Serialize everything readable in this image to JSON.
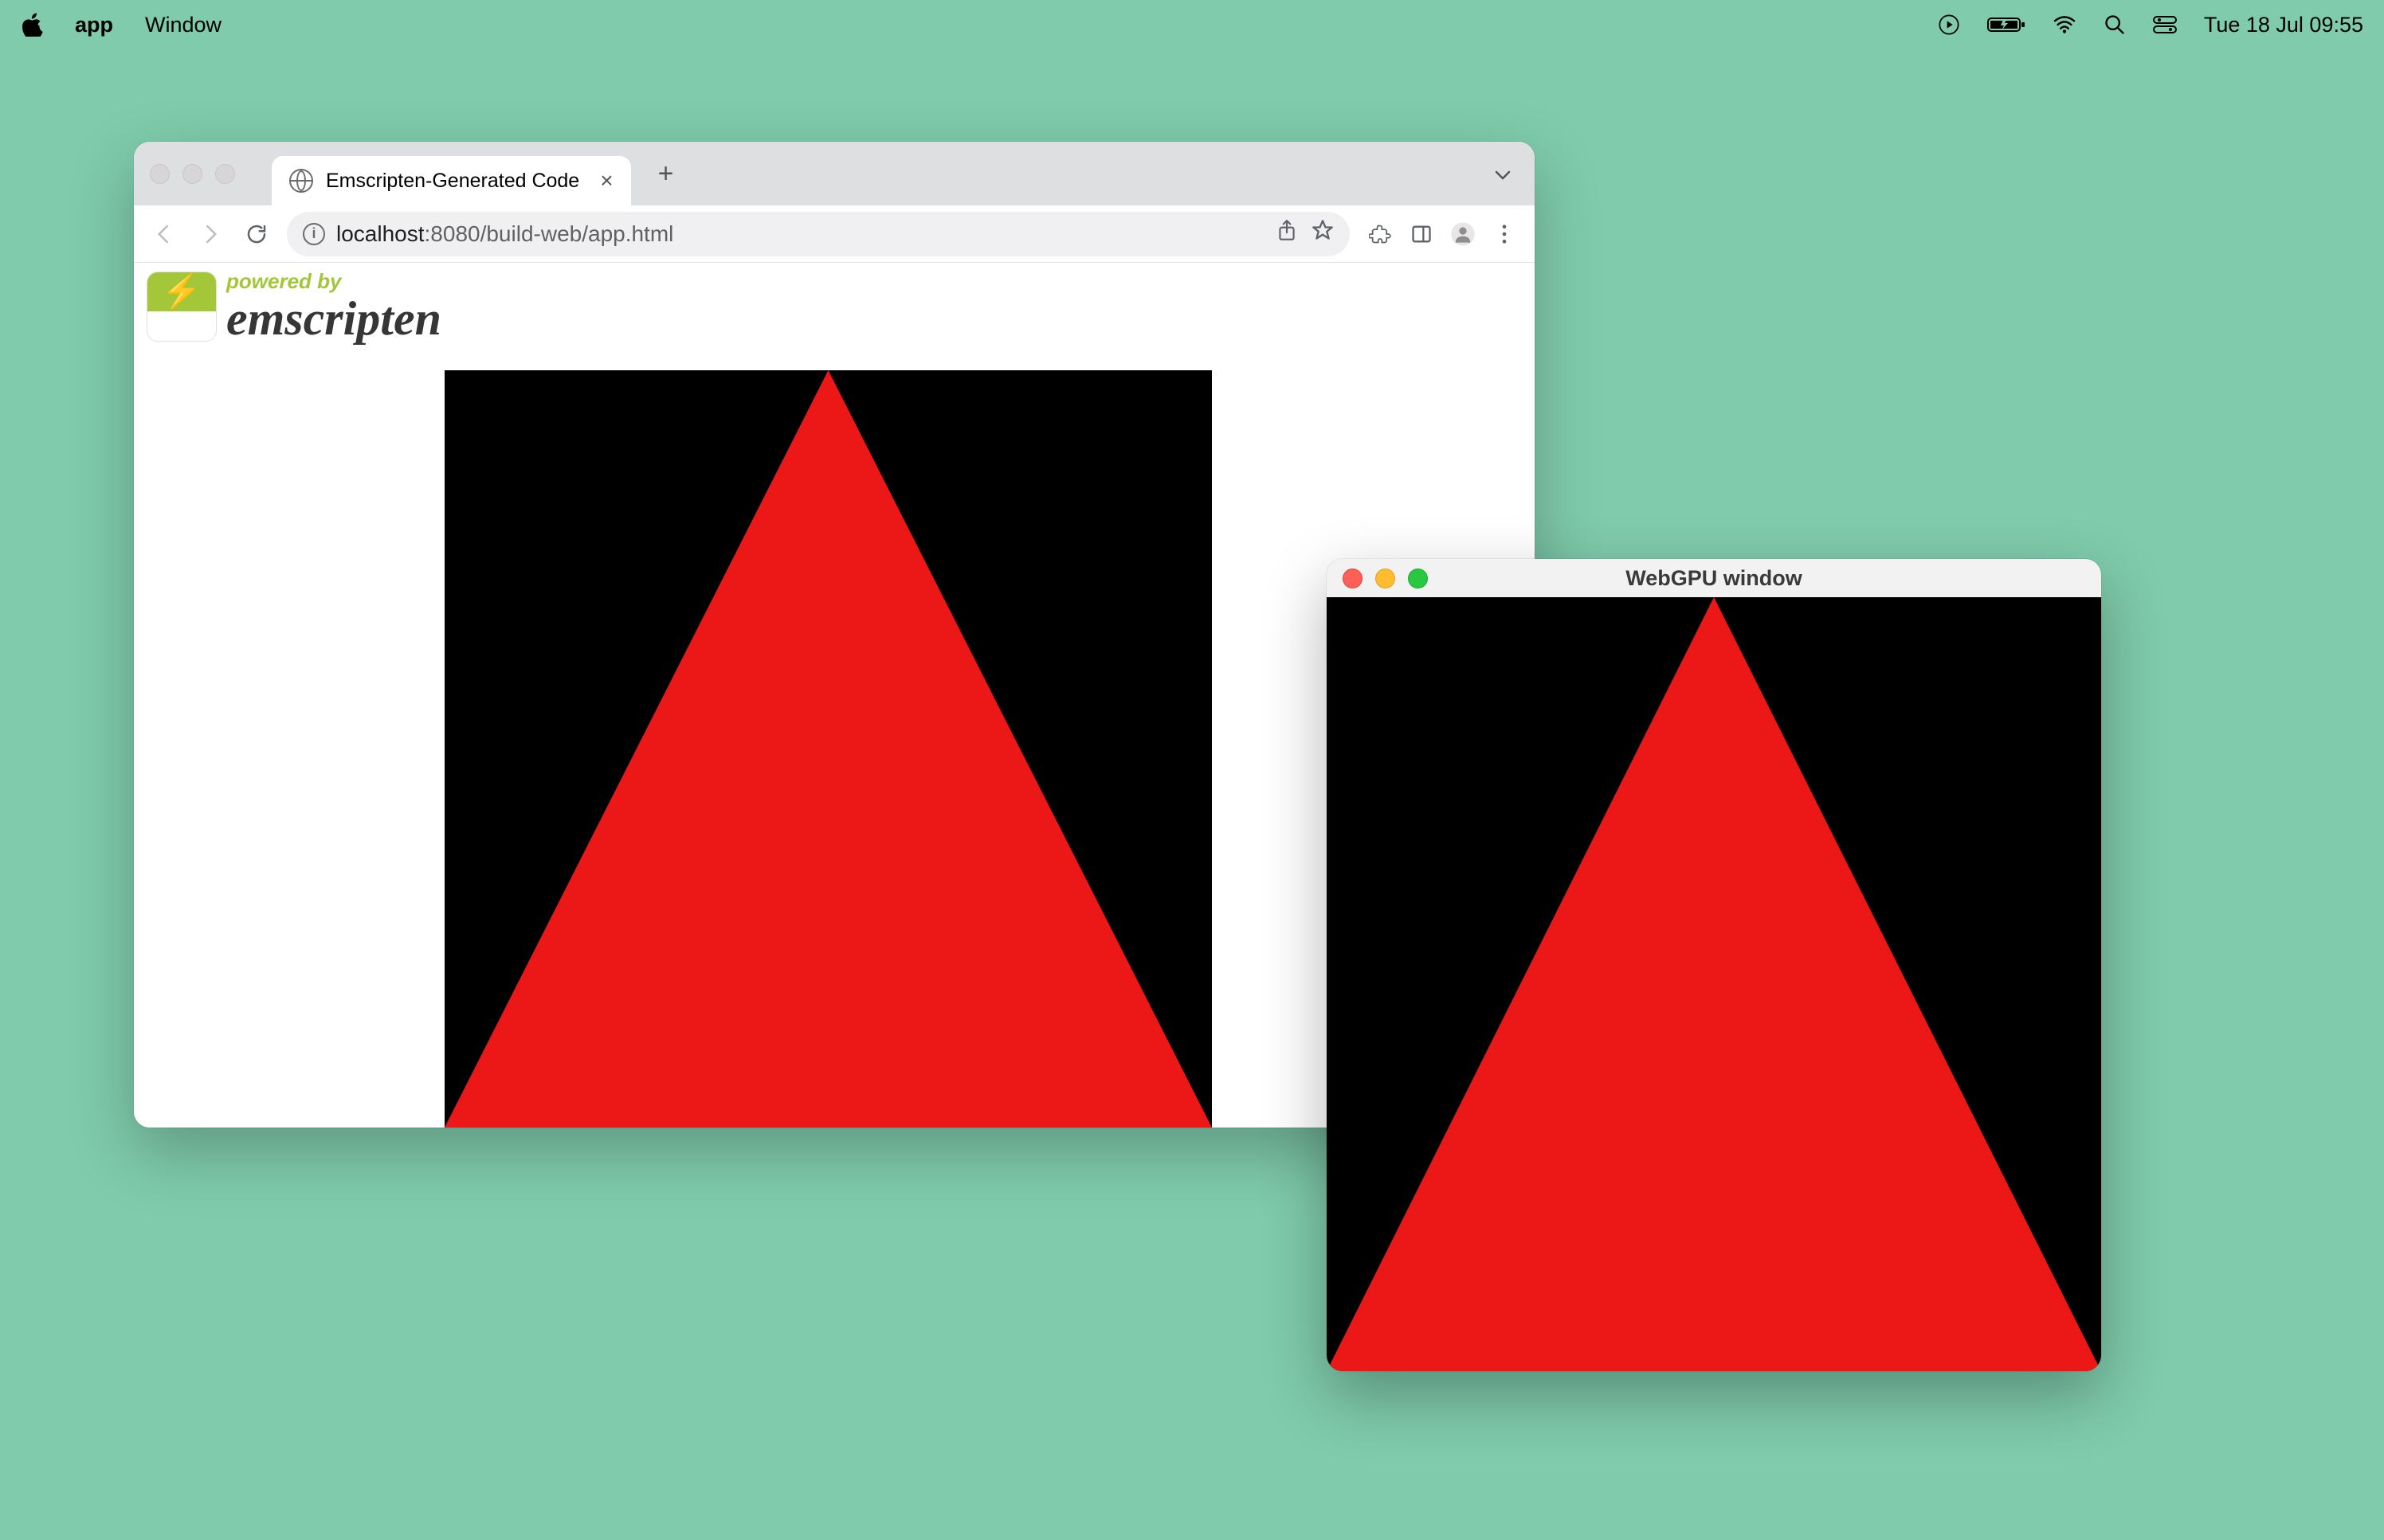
{
  "menubar": {
    "app_name": "app",
    "item_window": "Window",
    "clock": "Tue 18 Jul  09:55"
  },
  "browser": {
    "tab_title": "Emscripten-Generated Code",
    "url_host": "localhost",
    "url_port_path": ":8080/build-web/app.html",
    "logo_powered": "powered by",
    "logo_title": "emscripten"
  },
  "native": {
    "title": "WebGPU window"
  },
  "colors": {
    "desktop_bg": "#7fcbac",
    "triangle": "#ec1818",
    "canvas_bg": "#000000"
  }
}
